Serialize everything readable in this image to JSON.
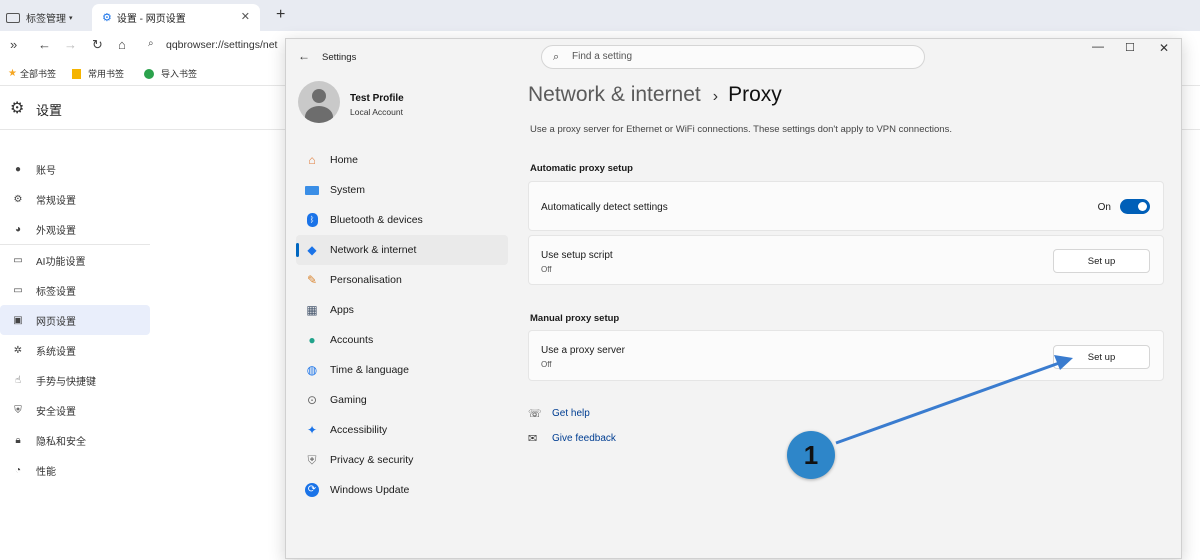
{
  "browser": {
    "tabs": [
      {
        "label": "标签管理",
        "icon": "tab-manager-icon"
      },
      {
        "label": "设置 - 网页设置",
        "icon": "gear-icon"
      }
    ],
    "address": "qqbrowser://settings/net",
    "bookmarks": [
      "全部书签",
      "常用书签",
      "导入书签"
    ]
  },
  "browser_settings": {
    "title": "设置",
    "nav": [
      {
        "label": "账号",
        "icon": "person-icon"
      },
      {
        "label": "常规设置",
        "icon": "gear-icon"
      },
      {
        "label": "外观设置",
        "icon": "palette-icon"
      },
      {
        "label": "AI功能设置",
        "icon": "ai-icon"
      },
      {
        "label": "标签设置",
        "icon": "tab-icon"
      },
      {
        "label": "网页设置",
        "icon": "webpage-icon",
        "selected": true
      },
      {
        "label": "系统设置",
        "icon": "system-gear-icon"
      },
      {
        "label": "手势与快捷键",
        "icon": "hand-icon"
      },
      {
        "label": "安全设置",
        "icon": "shield-icon"
      },
      {
        "label": "隐私和安全",
        "icon": "lock-icon"
      },
      {
        "label": "性能",
        "icon": "gauge-icon"
      }
    ]
  },
  "settings_window": {
    "title": "Settings",
    "search_placeholder": "Find a setting",
    "profile": {
      "name": "Test Profile",
      "type": "Local Account"
    },
    "nav": [
      {
        "label": "Home",
        "icon": "home-icon"
      },
      {
        "label": "System",
        "icon": "monitor-icon"
      },
      {
        "label": "Bluetooth & devices",
        "icon": "bluetooth-icon"
      },
      {
        "label": "Network & internet",
        "icon": "wifi-icon",
        "selected": true
      },
      {
        "label": "Personalisation",
        "icon": "brush-icon"
      },
      {
        "label": "Apps",
        "icon": "apps-icon"
      },
      {
        "label": "Accounts",
        "icon": "accounts-icon"
      },
      {
        "label": "Time & language",
        "icon": "globe-clock-icon"
      },
      {
        "label": "Gaming",
        "icon": "gamepad-icon"
      },
      {
        "label": "Accessibility",
        "icon": "accessibility-icon"
      },
      {
        "label": "Privacy & security",
        "icon": "shield-icon"
      },
      {
        "label": "Windows Update",
        "icon": "update-icon"
      }
    ],
    "breadcrumb": {
      "parent": "Network & internet",
      "current": "Proxy"
    },
    "description": "Use a proxy server for Ethernet or WiFi connections. These settings don't apply to VPN connections.",
    "automatic_section": "Automatic proxy setup",
    "auto_detect": {
      "label": "Automatically detect settings",
      "state_label": "On",
      "on": true
    },
    "setup_script": {
      "label": "Use setup script",
      "sub": "Off",
      "button": "Set up"
    },
    "manual_section": "Manual proxy setup",
    "proxy_server": {
      "label": "Use a proxy server",
      "sub": "Off",
      "button": "Set up"
    },
    "links": [
      {
        "label": "Get help",
        "icon": "help-icon"
      },
      {
        "label": "Give feedback",
        "icon": "feedback-icon"
      }
    ]
  },
  "annotation": {
    "number": "1",
    "color": "#2e86c9"
  }
}
